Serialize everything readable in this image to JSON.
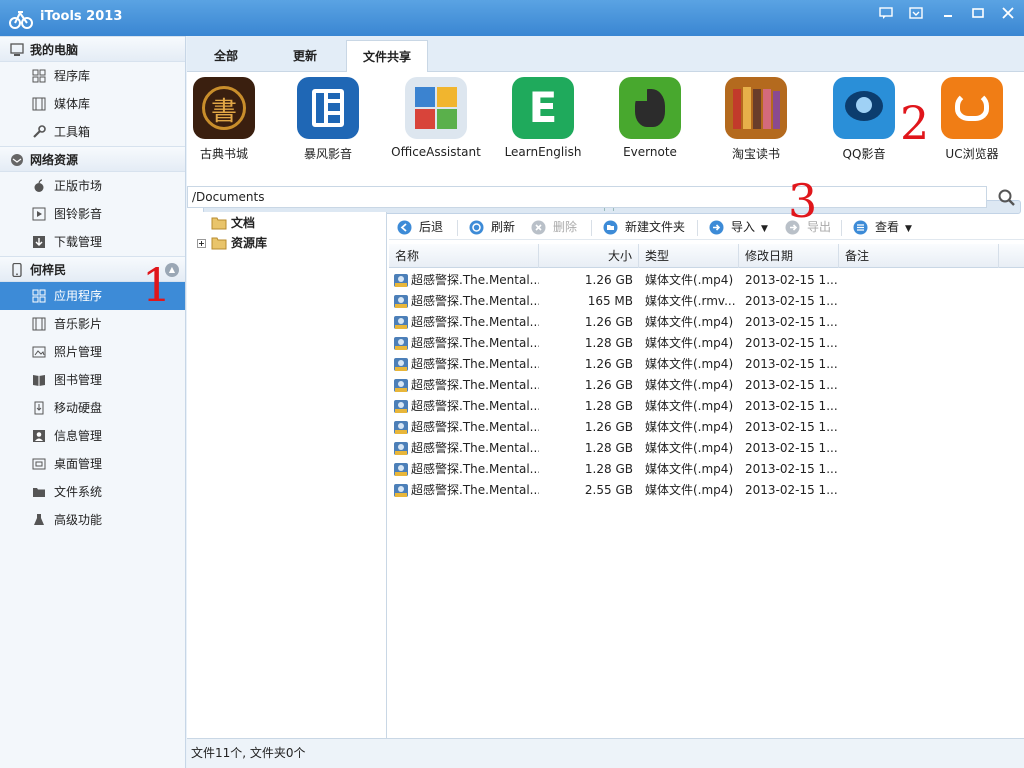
{
  "window": {
    "title": "iTools 2013"
  },
  "sidebar": {
    "sections": [
      {
        "title": "我的电脑",
        "items": [
          "程序库",
          "媒体库",
          "工具箱"
        ]
      },
      {
        "title": "网络资源",
        "items": [
          "正版市场",
          "图铃影音",
          "下载管理"
        ]
      },
      {
        "title": "何梓民",
        "items": [
          "应用程序",
          "音乐影片",
          "照片管理",
          "图书管理",
          "移动硬盘",
          "信息管理",
          "桌面管理",
          "文件系统",
          "高级功能"
        ]
      }
    ],
    "selected": "应用程序"
  },
  "tabs": [
    "全部",
    "更新",
    "文件共享"
  ],
  "active_tab": "文件共享",
  "apps": [
    {
      "name": "古典书城",
      "color": "#3a1f0f"
    },
    {
      "name": "暴风影音",
      "color": "#1f67b5"
    },
    {
      "name": "OfficeAssistant",
      "color": "#9fb3c8"
    },
    {
      "name": "LearnEnglish",
      "color": "#1faa5c"
    },
    {
      "name": "Evernote",
      "color": "#48a82e"
    },
    {
      "name": "淘宝读书",
      "color": "#b46a1e"
    },
    {
      "name": "QQ影音",
      "color": "#2a8fd8"
    },
    {
      "name": "UC浏览器",
      "color": "#f07d15"
    }
  ],
  "path": {
    "value": "/Documents"
  },
  "tree": [
    {
      "label": "文档",
      "expandable": false
    },
    {
      "label": "资源库",
      "expandable": true
    }
  ],
  "toolbar": {
    "back": "后退",
    "refresh": "刷新",
    "delete": "删除",
    "new_folder": "新建文件夹",
    "import": "导入",
    "export": "导出",
    "view": "查看"
  },
  "columns": [
    "名称",
    "大小",
    "类型",
    "修改日期",
    "备注"
  ],
  "files": [
    {
      "name": "超感警探.The.Mental...",
      "size": "1.26 GB",
      "type": "媒体文件(.mp4)",
      "date": "2013-02-15 1..."
    },
    {
      "name": "超感警探.The.Mental...",
      "size": "165 MB",
      "type": "媒体文件(.rmv...",
      "date": "2013-02-15 1..."
    },
    {
      "name": "超感警探.The.Mental...",
      "size": "1.26 GB",
      "type": "媒体文件(.mp4)",
      "date": "2013-02-15 1..."
    },
    {
      "name": "超感警探.The.Mental...",
      "size": "1.28 GB",
      "type": "媒体文件(.mp4)",
      "date": "2013-02-15 1..."
    },
    {
      "name": "超感警探.The.Mental...",
      "size": "1.26 GB",
      "type": "媒体文件(.mp4)",
      "date": "2013-02-15 1..."
    },
    {
      "name": "超感警探.The.Mental...",
      "size": "1.26 GB",
      "type": "媒体文件(.mp4)",
      "date": "2013-02-15 1..."
    },
    {
      "name": "超感警探.The.Mental...",
      "size": "1.28 GB",
      "type": "媒体文件(.mp4)",
      "date": "2013-02-15 1..."
    },
    {
      "name": "超感警探.The.Mental...",
      "size": "1.26 GB",
      "type": "媒体文件(.mp4)",
      "date": "2013-02-15 1..."
    },
    {
      "name": "超感警探.The.Mental...",
      "size": "1.28 GB",
      "type": "媒体文件(.mp4)",
      "date": "2013-02-15 1..."
    },
    {
      "name": "超感警探.The.Mental...",
      "size": "1.28 GB",
      "type": "媒体文件(.mp4)",
      "date": "2013-02-15 1..."
    },
    {
      "name": "超感警探.The.Mental...",
      "size": "2.55 GB",
      "type": "媒体文件(.mp4)",
      "date": "2013-02-15 1..."
    }
  ],
  "status": "文件11个, 文件夹0个",
  "annotations": [
    "1",
    "2",
    "3"
  ],
  "colors": {
    "accent": "#3d8bd7",
    "title_bar": "#3a86d2",
    "annotation": "#e0161b"
  }
}
